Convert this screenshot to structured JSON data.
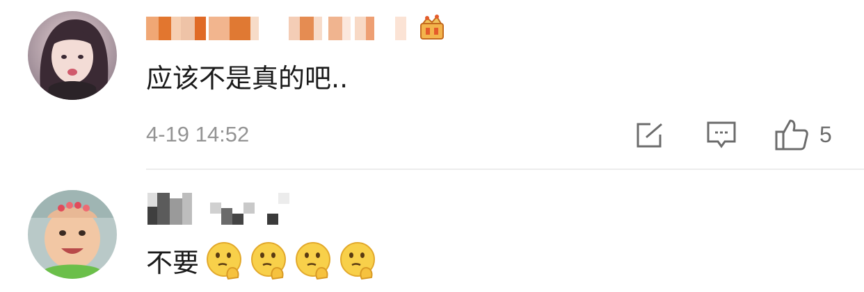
{
  "comments": [
    {
      "username": "(pixelated username)",
      "text": "应该不是真的吧..",
      "timestamp": "4-19 14:52",
      "like_count": "5",
      "badge_icon": "vip-crown-badge-icon"
    },
    {
      "username": "(pixelated username)",
      "text": "不要",
      "emoji_icon": "thinking-emoji-icon",
      "emoji_count": 4
    }
  ],
  "icons": {
    "share": "share-icon",
    "comment": "comment-icon",
    "like": "thumbs-up-icon"
  },
  "colors": {
    "text": "#1a1a1a",
    "meta": "#939393",
    "icon": "#6b6b6b",
    "badge": "#e8a33a"
  }
}
